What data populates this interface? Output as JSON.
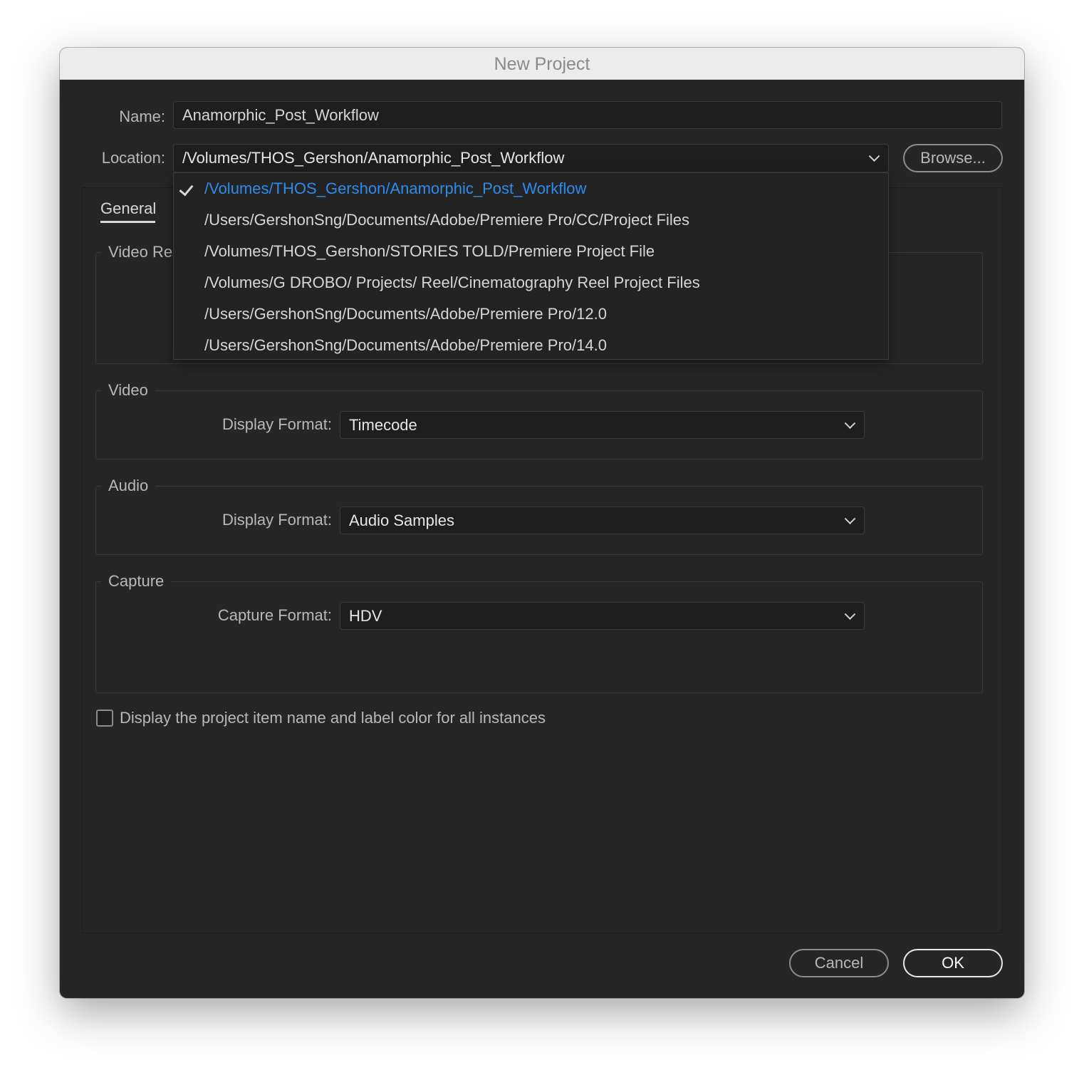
{
  "window": {
    "title": "New Project"
  },
  "name_field": {
    "label": "Name:",
    "value": "Anamorphic_Post_Workflow"
  },
  "location": {
    "label": "Location:",
    "selected": "/Volumes/THOS_Gershon/Anamorphic_Post_Workflow",
    "browse_label": "Browse...",
    "options": [
      "/Volumes/THOS_Gershon/Anamorphic_Post_Workflow",
      "/Users/GershonSng/Documents/Adobe/Premiere Pro/CC/Project Files",
      "/Volumes/THOS_Gershon/STORIES TOLD/Premiere Project File",
      "/Volumes/G DROBO/ Projects/ Reel/Cinematography Reel Project Files",
      "/Users/GershonSng/Documents/Adobe/Premiere Pro/12.0",
      "/Users/GershonSng/Documents/Adobe/Premiere Pro/14.0"
    ],
    "selected_index": 0
  },
  "tabs": {
    "general": "General"
  },
  "video_rendering": {
    "title_partial": "Video Re"
  },
  "video": {
    "title": "Video",
    "display_format_label": "Display Format:",
    "display_format_value": "Timecode"
  },
  "audio": {
    "title": "Audio",
    "display_format_label": "Display Format:",
    "display_format_value": "Audio Samples"
  },
  "capture": {
    "title": "Capture",
    "capture_format_label": "Capture Format:",
    "capture_format_value": "HDV"
  },
  "checkbox": {
    "label": "Display the project item name and label color for all instances",
    "checked": false
  },
  "buttons": {
    "cancel": "Cancel",
    "ok": "OK"
  },
  "colors": {
    "dialog_bg": "#262626",
    "selected_item": "#2d8ceb",
    "titlebar": "#ececec"
  }
}
